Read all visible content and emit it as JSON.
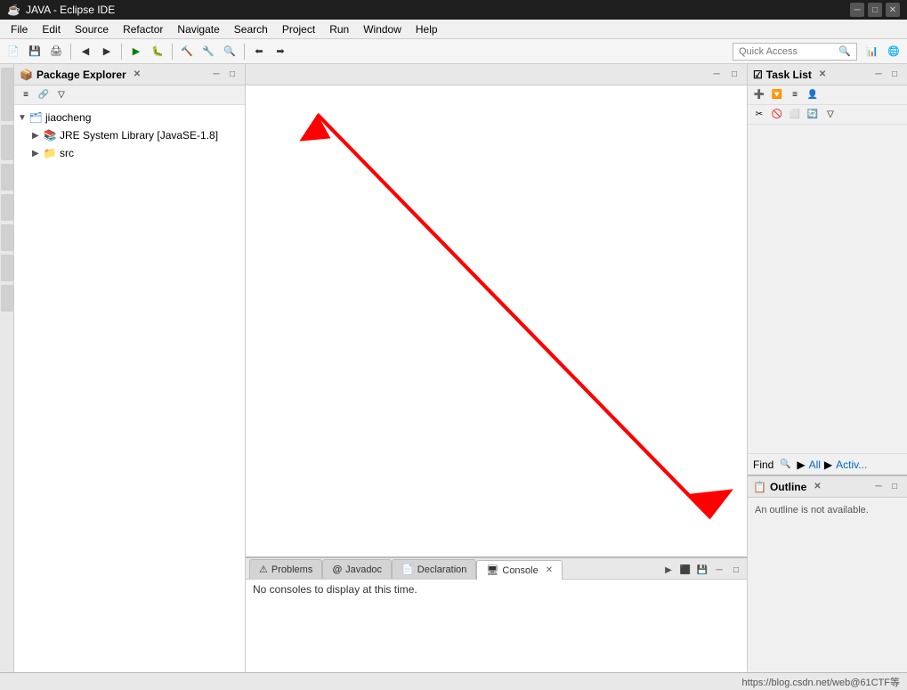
{
  "window": {
    "title": "JAVA - Eclipse IDE",
    "icon": "☕"
  },
  "menubar": {
    "items": [
      "File",
      "Edit",
      "Source",
      "Refactor",
      "Navigate",
      "Search",
      "Project",
      "Run",
      "Window",
      "Help"
    ]
  },
  "toolbar": {
    "quick_access_placeholder": "Quick Access",
    "quick_access_label": "Quick Access"
  },
  "package_explorer": {
    "title": "Package Explorer",
    "tree": {
      "root": "jiaocheng",
      "items": [
        {
          "label": "jiaocheng",
          "type": "project",
          "indent": 0,
          "expanded": true
        },
        {
          "label": "JRE System Library [JavaSE-1.8]",
          "type": "library",
          "indent": 1,
          "expanded": false
        },
        {
          "label": "src",
          "type": "folder",
          "indent": 1,
          "expanded": false
        }
      ]
    }
  },
  "task_list": {
    "title": "Task List",
    "find_placeholder": "Find",
    "filter_labels": [
      "All",
      "Activ..."
    ]
  },
  "outline": {
    "title": "Outline",
    "message": "An outline is not available."
  },
  "bottom_panel": {
    "tabs": [
      {
        "label": "Problems",
        "icon": "⚠",
        "active": false
      },
      {
        "label": "Javadoc",
        "icon": "@",
        "active": false
      },
      {
        "label": "Declaration",
        "icon": "📄",
        "active": false
      },
      {
        "label": "Console",
        "icon": "🖥",
        "active": true
      }
    ],
    "console_message": "No consoles to display at this time."
  },
  "status_bar": {
    "url": "https://blog.csdn.net/web@61CTF等"
  }
}
